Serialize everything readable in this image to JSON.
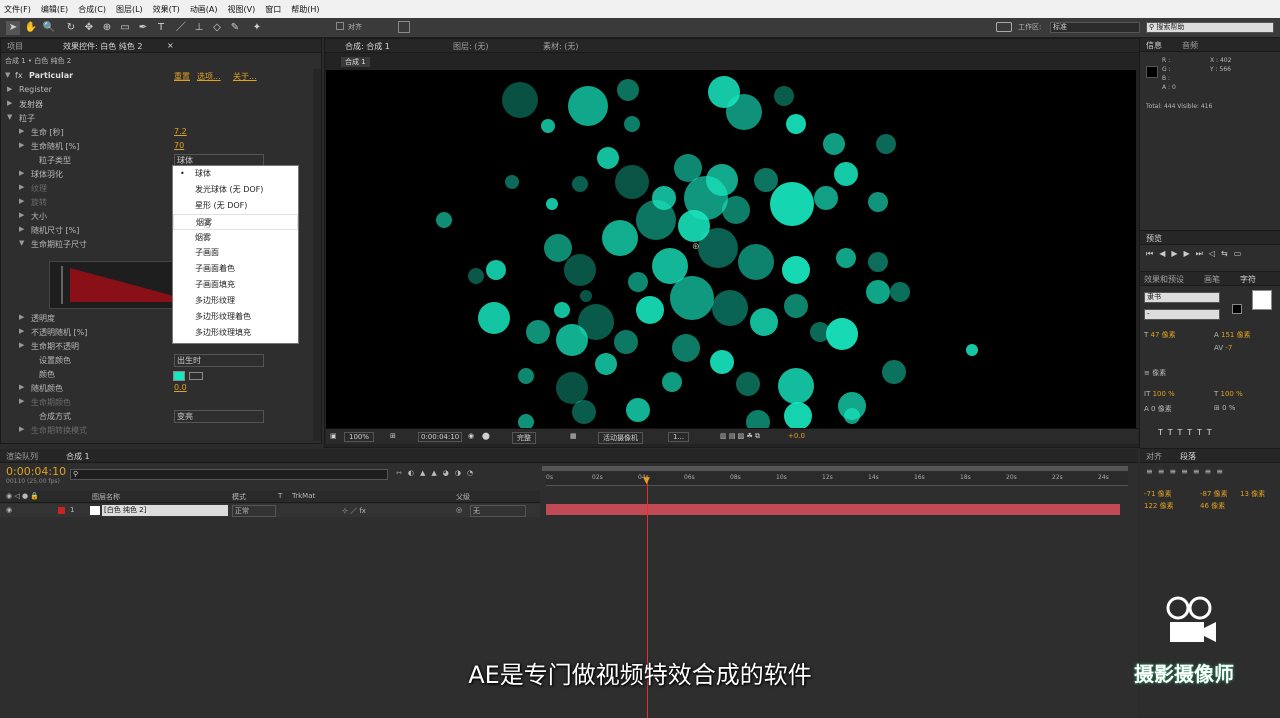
{
  "menu": [
    "文件(F)",
    "编辑(E)",
    "合成(C)",
    "图层(L)",
    "效果(T)",
    "动画(A)",
    "视图(V)",
    "窗口",
    "帮助(H)"
  ],
  "toolbar": {
    "align_label": "对齐",
    "workspace_label": "工作区:",
    "workspace_value": "标准",
    "search_placeholder": "搜索帮助"
  },
  "left_panel": {
    "tabs": [
      "项目",
      "效果控件: 白色 纯色 2"
    ],
    "breadcrumb": "合成 1 • 白色 纯色 2",
    "effect_name": "Particular",
    "effect_links": [
      "重置",
      "选项...",
      "关于..."
    ],
    "rows": [
      {
        "label": "Register",
        "value": ""
      },
      {
        "label": "发射器",
        "value": ""
      },
      {
        "label": "粒子",
        "value": ""
      },
      {
        "label": "生命 [秒]",
        "value": "7.2"
      },
      {
        "label": "生命随机 [%]",
        "value": "70"
      },
      {
        "label": "粒子类型",
        "value": "球体"
      },
      {
        "label": "球体羽化",
        "value": ""
      },
      {
        "label": "纹理",
        "value": ""
      },
      {
        "label": "旋转",
        "value": ""
      },
      {
        "label": "大小",
        "value": ""
      },
      {
        "label": "随机尺寸 [%]",
        "value": ""
      },
      {
        "label": "生命期粒子尺寸",
        "value": ""
      },
      {
        "label": "透明度",
        "value": ""
      },
      {
        "label": "不透明随机 [%]",
        "value": ""
      },
      {
        "label": "生命期不透明",
        "value": ""
      },
      {
        "label": "设置颜色",
        "value": "出生时"
      },
      {
        "label": "颜色",
        "value": ""
      },
      {
        "label": "随机颜色",
        "value": "0.0"
      },
      {
        "label": "生命期颜色",
        "value": ""
      },
      {
        "label": "合成方式",
        "value": "变亮"
      },
      {
        "label": "生命期转换模式",
        "value": ""
      }
    ]
  },
  "dropdown": {
    "items": [
      "球体",
      "发光球体 (无 DOF)",
      "星形 (无 DOF)",
      "烟雾",
      "烟雾",
      "子画面",
      "子画面着色",
      "子画面填充",
      "多边形纹理",
      "多边形纹理着色",
      "多边形纹理填充"
    ],
    "selected": "球体",
    "hovered": "烟雾"
  },
  "comp_panel": {
    "tabs": [
      "合成: 合成 1",
      "图层: (无)",
      "素材: (无)"
    ],
    "subtab": "合成 1",
    "zoom": "100%",
    "timecode": "0:00:04:10",
    "quality": "完整",
    "camera": "活动摄像机",
    "views": "1...",
    "exposure": "+0.0"
  },
  "timeline": {
    "tabs": [
      "渲染队列",
      "合成 1"
    ],
    "timecode": "0:00:04:10",
    "frames": "00110 (25.00 fps)",
    "columns": [
      "图层名称",
      "模式",
      "T",
      "TrkMat",
      "父级"
    ],
    "layer": {
      "index": "1",
      "name": "[白色 纯色 2]",
      "mode": "正常",
      "parent": "无"
    },
    "ticks": [
      "0s",
      "02s",
      "04s",
      "06s",
      "08s",
      "10s",
      "12s",
      "14s",
      "16s",
      "18s",
      "20s",
      "22s",
      "24s"
    ]
  },
  "info_panel": {
    "tabs": [
      "信息",
      "音频"
    ],
    "r": "R :",
    "g": "G :",
    "b": "B :",
    "a": "A : 0",
    "x": "X : 402",
    "y": "Y : 566",
    "total": "Total: 444  Visible: 416"
  },
  "preview_panel": {
    "tab": "预览"
  },
  "char_panel": {
    "tabs": [
      "效果和预设",
      "画笔",
      "字符"
    ],
    "font": "隶书",
    "size": "47 像素",
    "leading": "151 像素",
    "tracking": "-7",
    "stroke": "像素",
    "vscale": "100 %",
    "hscale": "100 %",
    "baseline": "0 像素",
    "tsume": "0 %"
  },
  "para_panel": {
    "tabs": [
      "对齐",
      "段落"
    ],
    "indent1": "-71 像素",
    "indent2": "-87 像素",
    "indent3": "13 像素",
    "space1": "122 像素",
    "space2": "46 像素"
  },
  "subtitle": "AE是专门做视频特效合成的软件",
  "watermark": "摄影摄像师",
  "colors": {
    "particle": "#18e8c0",
    "accent": "#e0a020",
    "layer_bar": "#c24a55"
  }
}
